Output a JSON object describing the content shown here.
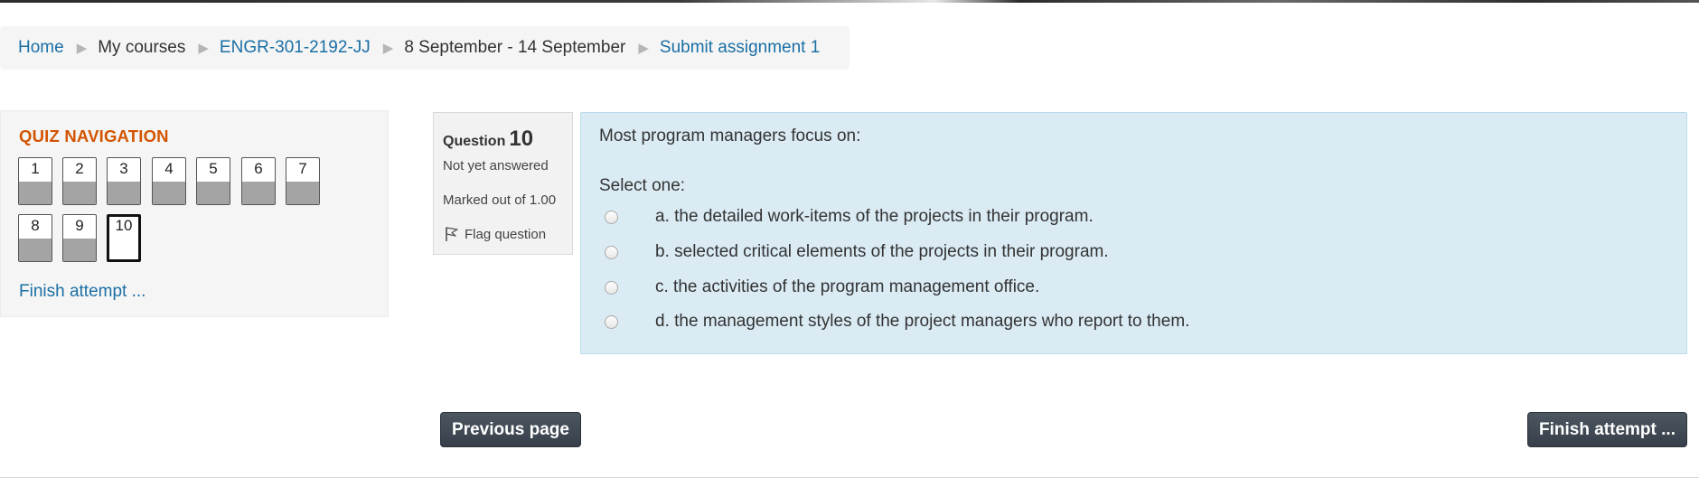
{
  "breadcrumb": {
    "items": [
      {
        "label": "Home",
        "link": true
      },
      {
        "label": "My courses",
        "link": false
      },
      {
        "label": "ENGR-301-2192-JJ",
        "link": true
      },
      {
        "label": "8 September - 14 September",
        "link": false
      },
      {
        "label": "Submit assignment 1",
        "link": true
      }
    ],
    "separator": "▶"
  },
  "quiz_navigation": {
    "title": "QUIZ NAVIGATION",
    "buttons": [
      {
        "label": "1",
        "answered": true,
        "current": false
      },
      {
        "label": "2",
        "answered": true,
        "current": false
      },
      {
        "label": "3",
        "answered": true,
        "current": false
      },
      {
        "label": "4",
        "answered": true,
        "current": false
      },
      {
        "label": "5",
        "answered": true,
        "current": false
      },
      {
        "label": "6",
        "answered": true,
        "current": false
      },
      {
        "label": "7",
        "answered": true,
        "current": false
      },
      {
        "label": "8",
        "answered": true,
        "current": false
      },
      {
        "label": "9",
        "answered": true,
        "current": false
      },
      {
        "label": "10",
        "answered": false,
        "current": true
      }
    ],
    "finish_link": "Finish attempt ..."
  },
  "question_info": {
    "label": "Question",
    "number": "10",
    "state": "Not yet answered",
    "grade": "Marked out of 1.00",
    "flag": "Flag question",
    "flag_icon": "flag-icon"
  },
  "question": {
    "text": "Most program managers focus on:",
    "prompt": "Select one:",
    "answers": [
      {
        "label": "a. the detailed work-items of the projects in their program.",
        "selected": false
      },
      {
        "label": "b. selected critical elements of the projects in their program.",
        "selected": false
      },
      {
        "label": "c. the activities of the program management office.",
        "selected": false
      },
      {
        "label": "d. the management styles of the project managers who report to them.",
        "selected": false
      }
    ]
  },
  "navigation": {
    "previous": "Previous page",
    "finish": "Finish attempt ..."
  },
  "colors": {
    "link": "#1a6fa4",
    "nav_title": "#d35400",
    "question_bg": "#daebf4",
    "button_bg": "#404952"
  }
}
